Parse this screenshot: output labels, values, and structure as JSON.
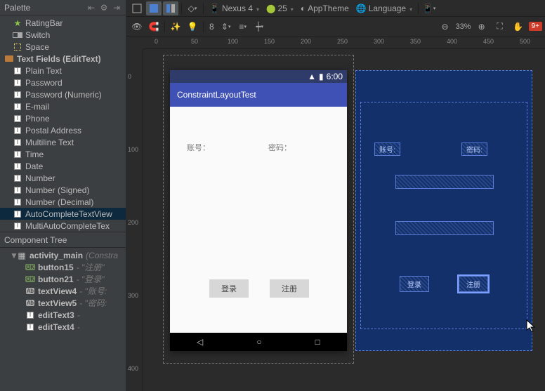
{
  "palette": {
    "title": "Palette",
    "items": [
      {
        "icon": "star",
        "label": "RatingBar"
      },
      {
        "icon": "switch",
        "label": "Switch"
      },
      {
        "icon": "space",
        "label": "Space"
      }
    ],
    "group": {
      "icon": "folder",
      "label": "Text Fields (EditText)"
    },
    "text_fields": [
      "Plain Text",
      "Password",
      "Password (Numeric)",
      "E-mail",
      "Phone",
      "Postal Address",
      "Multiline Text",
      "Time",
      "Date",
      "Number",
      "Number (Signed)",
      "Number (Decimal)",
      "AutoCompleteTextView",
      "MultiAutoCompleteTex"
    ]
  },
  "component_tree": {
    "title": "Component Tree",
    "root": {
      "name": "activity_main",
      "hint": "(Constra"
    },
    "children": [
      {
        "badge": "ok",
        "name": "button15",
        "hint": "\"注册\""
      },
      {
        "badge": "ok",
        "name": "button21",
        "hint": "\"登录\""
      },
      {
        "badge": "ab",
        "name": "textView4",
        "hint": "\"账号:"
      },
      {
        "badge": "ab",
        "name": "textView5",
        "hint": "\"密码:"
      },
      {
        "badge": "txt",
        "name": "editText3",
        "hint": ""
      },
      {
        "badge": "txt",
        "name": "editText4",
        "hint": ""
      }
    ]
  },
  "toolbar1": {
    "device": "Nexus 4",
    "api": "25",
    "theme": "AppTheme",
    "lang": "Language"
  },
  "toolbar2": {
    "sample_n": "8",
    "zoom": "33%",
    "warnings": "9+"
  },
  "ruler_h": [
    "0",
    "50",
    "100",
    "150",
    "200",
    "250",
    "300",
    "350",
    "400",
    "450",
    "500"
  ],
  "ruler_v": [
    "0",
    "100",
    "200",
    "300",
    "400"
  ],
  "device_preview": {
    "status_time": "6:00",
    "app_title": "ConstraintLayoutTest",
    "label_account": "账号：",
    "label_password": "密码：",
    "btn_login": "登录",
    "btn_register": "注册"
  },
  "blueprint": {
    "lbl_account": "账号:",
    "lbl_password": "密码:",
    "btn_login": "登录",
    "btn_register": "注册"
  }
}
